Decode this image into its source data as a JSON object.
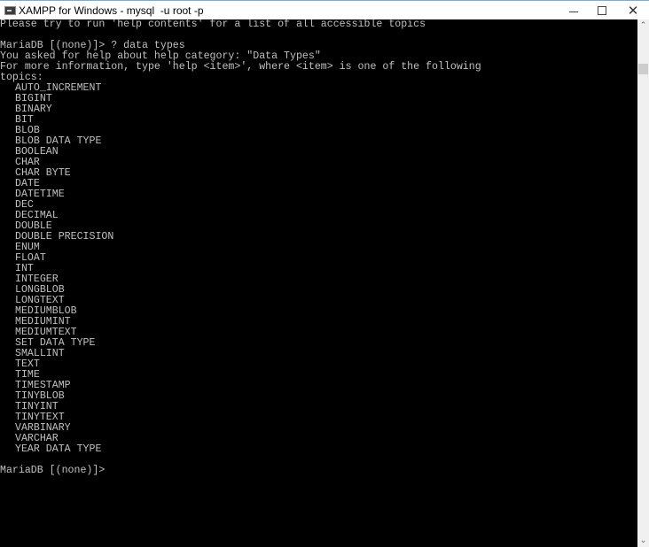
{
  "window": {
    "title": "XAMPP for Windows - mysql  -u root -p",
    "icon": "console-icon",
    "controls": {
      "minimize_icon": "minimize-icon",
      "maximize_icon": "maximize-icon",
      "close_icon": "close-icon",
      "close_glyph": "✕"
    }
  },
  "console": {
    "header_lines": [
      "Please try to run 'help contents' for a list of all accessible topics",
      "",
      "MariaDB [(none)]> ? data types",
      "You asked for help about help category: \"Data Types\"",
      "For more information, type 'help <item>', where <item> is one of the following",
      "topics:"
    ],
    "topics": [
      "AUTO_INCREMENT",
      "BIGINT",
      "BINARY",
      "BIT",
      "BLOB",
      "BLOB DATA TYPE",
      "BOOLEAN",
      "CHAR",
      "CHAR BYTE",
      "DATE",
      "DATETIME",
      "DEC",
      "DECIMAL",
      "DOUBLE",
      "DOUBLE PRECISION",
      "ENUM",
      "FLOAT",
      "INT",
      "INTEGER",
      "LONGBLOB",
      "LONGTEXT",
      "MEDIUMBLOB",
      "MEDIUMINT",
      "MEDIUMTEXT",
      "SET DATA TYPE",
      "SMALLINT",
      "TEXT",
      "TIME",
      "TIMESTAMP",
      "TINYBLOB",
      "TINYINT",
      "TINYTEXT",
      "VARBINARY",
      "VARCHAR",
      "YEAR DATA TYPE"
    ],
    "blank_after_topics": "",
    "prompt": "MariaDB [(none)]> "
  },
  "scrollbar": {
    "up_glyph": "⌃",
    "down_glyph": "⌄"
  }
}
